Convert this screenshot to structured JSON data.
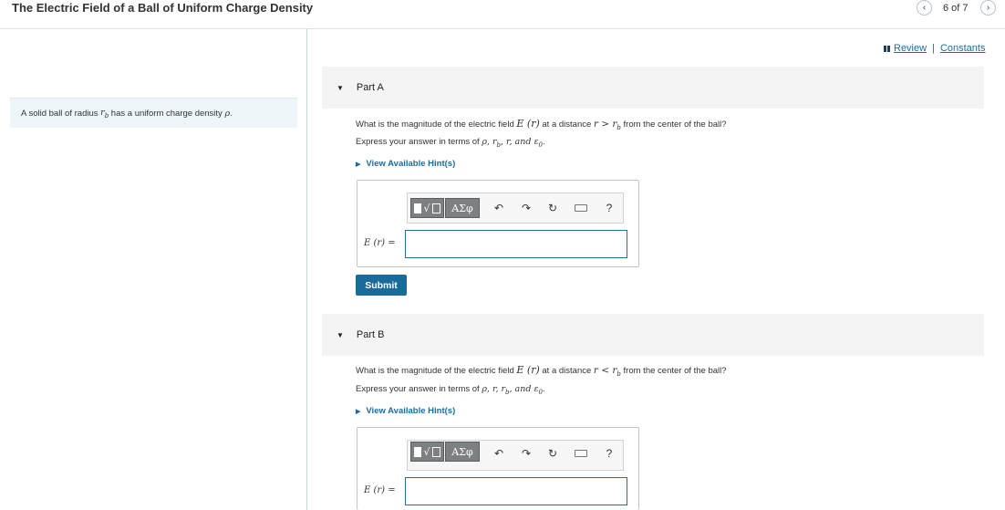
{
  "header": {
    "title": "The Electric Field of a Ball of Uniform Charge Density",
    "counter": "6 of 7",
    "prev_icon": "chevron-left-icon",
    "next_icon": "chevron-right-icon"
  },
  "links": {
    "review": "Review",
    "separator": "|",
    "constants": "Constants"
  },
  "intro": {
    "text_before": "A solid ball of radius ",
    "var_rb": "r",
    "var_rb_sub": "b",
    "text_middle": " has a uniform charge density ",
    "var_rho": "ρ",
    "text_end": "."
  },
  "parts": [
    {
      "label": "Part A",
      "question_before": "What is the magnitude of the electric field ",
      "question_field": "E (r)",
      "question_middle": " at a distance ",
      "question_cond": "r > r",
      "question_cond_sub": "b",
      "question_after": " from the center of the ball?",
      "express_before": "Express your answer in terms of ",
      "express_vars": "ρ, r",
      "express_vars_sub": "b",
      "express_vars_after": ", r, and ε",
      "express_eps_sub": "0",
      "express_end": ".",
      "hint": "View Available Hint(s)",
      "answer_label": "E (r) =",
      "answer_value": "",
      "submit": "Submit"
    },
    {
      "label": "Part B",
      "question_before": "What is the magnitude of the electric field ",
      "question_field": "E (r)",
      "question_middle": " at a distance ",
      "question_cond": "r < r",
      "question_cond_sub": "b",
      "question_after": " from the center of the ball?",
      "express_before": "Express your answer in terms of ",
      "express_vars": "ρ, r, r",
      "express_vars_sub": "b",
      "express_vars_after": ", and ε",
      "express_eps_sub": "0",
      "express_end": ".",
      "hint": "View Available Hint(s)",
      "answer_label": "E (r) =",
      "answer_value": ""
    }
  ],
  "toolbar": {
    "greek_button": "ΑΣφ",
    "help_label": "?",
    "icons": [
      "templates-icon",
      "greek-symbols-icon",
      "undo-icon",
      "redo-icon",
      "reset-icon",
      "keyboard-icon",
      "help-icon"
    ]
  },
  "colors": {
    "accent": "#1a6a9a",
    "link": "#1a6ea3",
    "intro_bg": "#eef5f8",
    "part_header_bg": "#f4f4f4"
  }
}
